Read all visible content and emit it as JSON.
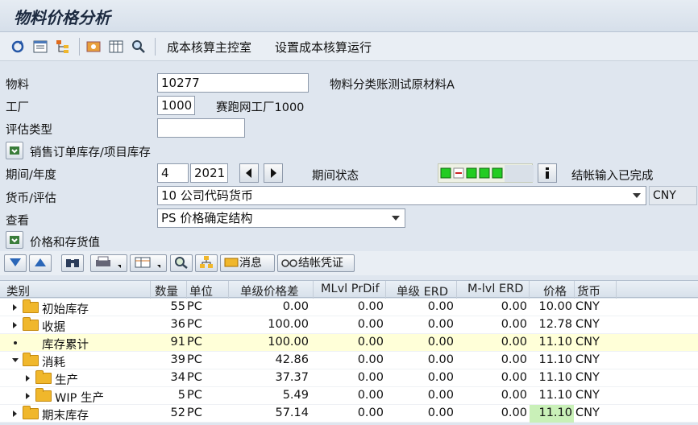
{
  "title": "物料价格分析",
  "toolbar": {
    "link1": "成本核算主控室",
    "link2": "设置成本核算运行"
  },
  "form": {
    "material_label": "物料",
    "material_value": "10277",
    "material_desc": "物料分类账测试原材料A",
    "plant_label": "工厂",
    "plant_value": "1000",
    "plant_desc": "赛跑网工厂1000",
    "valtype_label": "评估类型",
    "valtype_value": "",
    "sales_order_label": "销售订单库存/项目库存",
    "period_label": "期间/年度",
    "period_value": "4",
    "year_value": "2021",
    "period_status_label": "期间状态",
    "period_status_text": "结帐输入已完成",
    "currency_label": "货币/评估",
    "currency_value": "10 公司代码货币",
    "currency_code": "CNY",
    "view_label": "查看",
    "view_value": "PS 价格确定结构",
    "price_section_label": "价格和存货值"
  },
  "gridbar": {
    "msg_label": "消息",
    "close_label": "结帐凭证"
  },
  "columns": [
    "类别",
    "数量",
    "单位",
    "单级价格差",
    "MLvl PrDif",
    "单级 ERD",
    "M-lvl ERD",
    "价格",
    "货币"
  ],
  "rows": [
    {
      "category": "初始库存",
      "qty": "55",
      "unit": "PC",
      "single_diff": "0.00",
      "mlvl": "0.00",
      "serd": "0.00",
      "merd": "0.00",
      "price": "10.00",
      "curr": "CNY"
    },
    {
      "category": "收据",
      "qty": "36",
      "unit": "PC",
      "single_diff": "100.00",
      "mlvl": "0.00",
      "serd": "0.00",
      "merd": "0.00",
      "price": "12.78",
      "curr": "CNY"
    },
    {
      "category": "库存累计",
      "qty": "91",
      "unit": "PC",
      "single_diff": "100.00",
      "mlvl": "0.00",
      "serd": "0.00",
      "merd": "0.00",
      "price": "11.10",
      "curr": "CNY"
    },
    {
      "category": "消耗",
      "qty": "39",
      "unit": "PC",
      "single_diff": "42.86",
      "mlvl": "0.00",
      "serd": "0.00",
      "merd": "0.00",
      "price": "11.10",
      "curr": "CNY"
    },
    {
      "category": "生产",
      "qty": "34",
      "unit": "PC",
      "single_diff": "37.37",
      "mlvl": "0.00",
      "serd": "0.00",
      "merd": "0.00",
      "price": "11.10",
      "curr": "CNY"
    },
    {
      "category": "WIP 生产",
      "qty": "5",
      "unit": "PC",
      "single_diff": "5.49",
      "mlvl": "0.00",
      "serd": "0.00",
      "merd": "0.00",
      "price": "11.10",
      "curr": "CNY"
    },
    {
      "category": "期末库存",
      "qty": "52",
      "unit": "PC",
      "single_diff": "57.14",
      "mlvl": "0.00",
      "serd": "0.00",
      "merd": "0.00",
      "price": "11.10",
      "curr": "CNY"
    }
  ],
  "colors": {
    "folder": "#f0b72c",
    "highlight_row": "#ffffd8",
    "price_green": "#c9f0b8",
    "status_green": "#22cc22"
  }
}
